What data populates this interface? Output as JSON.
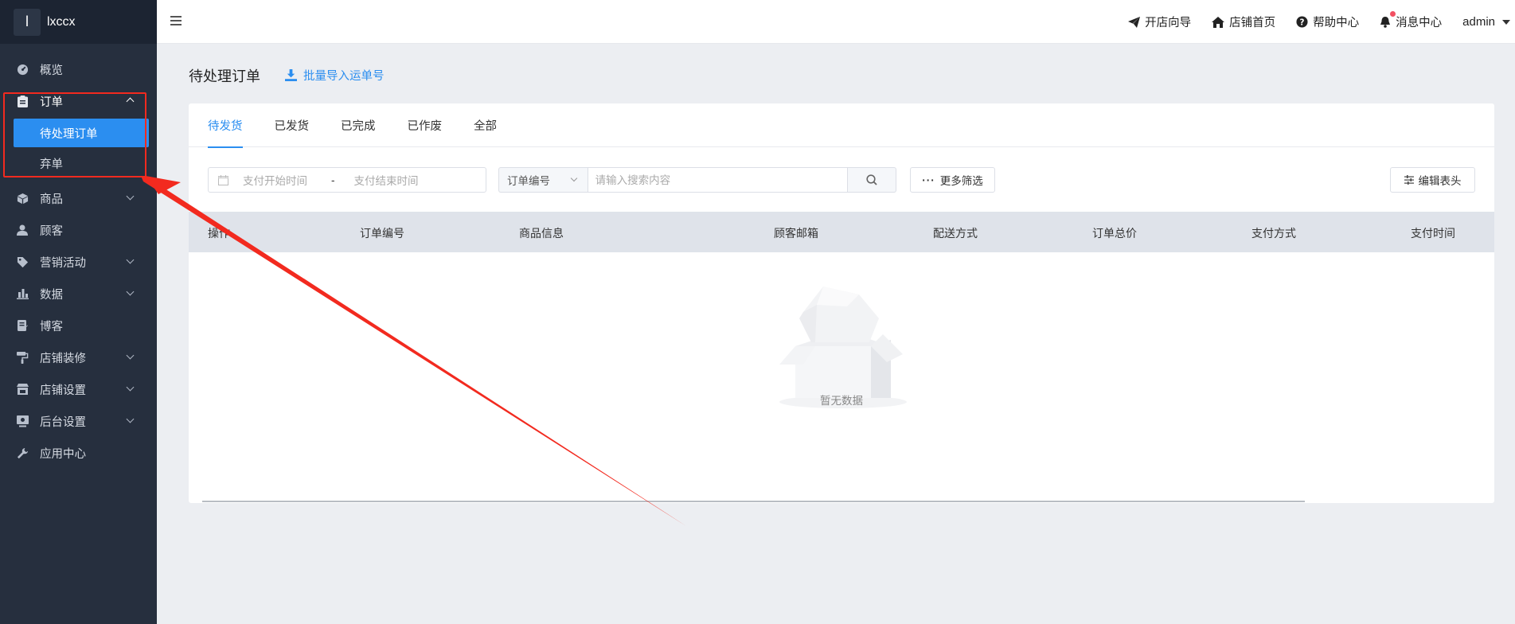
{
  "brand": {
    "logo_text": "l",
    "name": "lxccx"
  },
  "sidebar": {
    "items": [
      {
        "label": "概览",
        "icon": "dashboard-icon",
        "has_children": false
      },
      {
        "label": "订单",
        "icon": "clipboard-icon",
        "has_children": true,
        "open": true
      },
      {
        "label": "商品",
        "icon": "box-icon",
        "has_children": true
      },
      {
        "label": "顾客",
        "icon": "user-icon",
        "has_children": false
      },
      {
        "label": "营销活动",
        "icon": "tag-icon",
        "has_children": true
      },
      {
        "label": "数据",
        "icon": "bar-chart-icon",
        "has_children": true
      },
      {
        "label": "博客",
        "icon": "blog-icon",
        "has_children": false
      },
      {
        "label": "店铺装修",
        "icon": "paint-roller-icon",
        "has_children": true
      },
      {
        "label": "店铺设置",
        "icon": "store-icon",
        "has_children": true
      },
      {
        "label": "后台设置",
        "icon": "monitor-icon",
        "has_children": true
      },
      {
        "label": "应用中心",
        "icon": "wrench-icon",
        "has_children": false
      }
    ],
    "order_sub_items": [
      {
        "label": "待处理订单",
        "active": true
      },
      {
        "label": "弃单",
        "active": false
      }
    ]
  },
  "header": {
    "links": [
      {
        "label": "开店向导",
        "icon": "paper-plane-icon"
      },
      {
        "label": "店铺首页",
        "icon": "home-icon"
      },
      {
        "label": "帮助中心",
        "icon": "question-circle-icon"
      },
      {
        "label": "消息中心",
        "icon": "bell-icon"
      }
    ],
    "user": "admin"
  },
  "page": {
    "title": "待处理订单",
    "import_label": "批量导入运单号"
  },
  "tabs": [
    "待发货",
    "已发货",
    "已完成",
    "已作废",
    "全部"
  ],
  "active_tab": 0,
  "filters": {
    "date_start_placeholder": "支付开始时间",
    "date_separator": "-",
    "date_end_placeholder": "支付结束时间",
    "search_field": "订单编号",
    "search_placeholder": "请输入搜索内容",
    "more_filters": "更多筛选",
    "edit_columns": "编辑表头"
  },
  "table": {
    "columns": [
      "操作",
      "订单编号",
      "商品信息",
      "顾客邮箱",
      "配送方式",
      "订单总价",
      "支付方式",
      "支付时间"
    ],
    "empty_text": "暂无数据"
  },
  "colors": {
    "accent": "#2b8ef0",
    "sidebar_bg": "#262f3e",
    "annotation": "#f22a1f"
  }
}
